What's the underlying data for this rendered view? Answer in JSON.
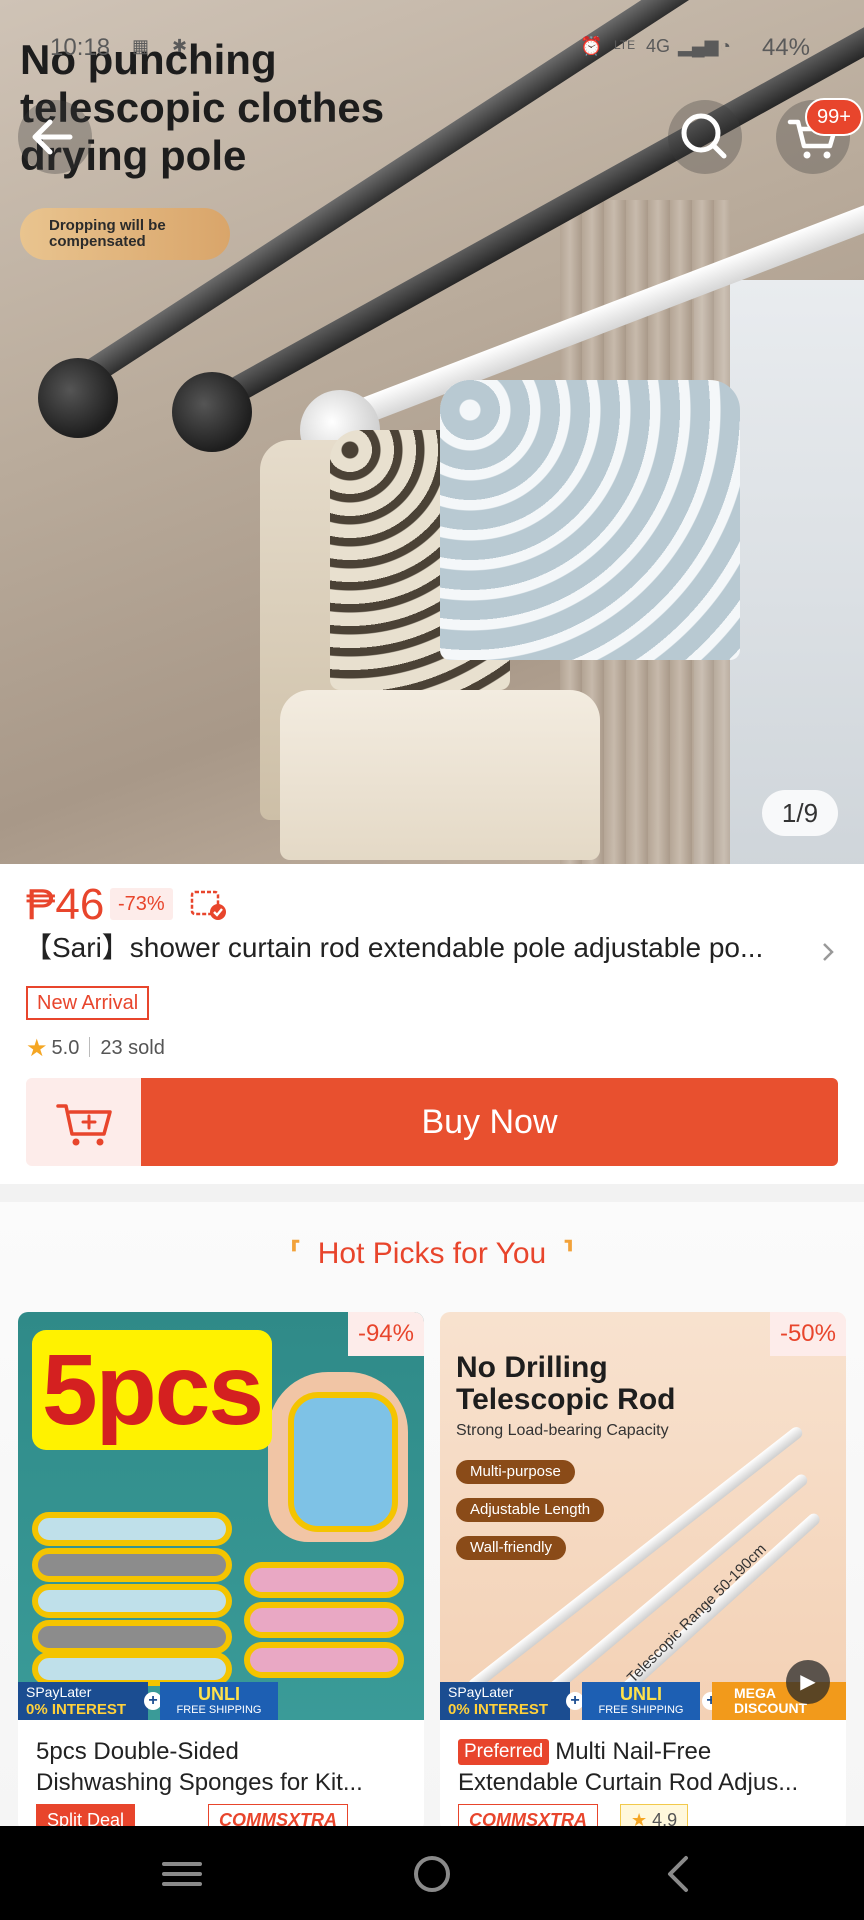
{
  "status_bar": {
    "time": "10:18",
    "network": "4G",
    "battery": "44%"
  },
  "gallery": {
    "headline": "No punching telescopic clothes drying pole",
    "pill_text": "Dropping will be compensated",
    "counter": "1/9",
    "cart_badge": "99+"
  },
  "product": {
    "price": "₱46",
    "discount": "-73%",
    "title": "【Sari】shower curtain rod  extendable pole adjustable po...",
    "tag": "New Arrival",
    "rating": "5.0",
    "sold": "23 sold",
    "buy_label": "Buy Now"
  },
  "hot_picks": {
    "heading": "Hot Picks for You",
    "items": [
      {
        "discount": "-94%",
        "image_text": "5pcs",
        "title_line1": "5pcs Double-Sided",
        "title_line2": "Dishwashing Sponges for Kit...",
        "chips": [
          "Split Deal",
          "COMMSXTRA"
        ],
        "promo": {
          "spay": "SPayLater",
          "interest": "0% INTEREST",
          "unli": "UNLI",
          "free_ship": "FREE SHIPPING"
        }
      },
      {
        "discount": "-50%",
        "image_title": "No Drilling Telescopic Rod",
        "image_sub": "Strong Load-bearing Capacity",
        "image_pills": [
          "Multi-purpose",
          "Adjustable Length",
          "Wall-friendly"
        ],
        "image_range": "Telescopic Range 50-190cm",
        "preferred": "Preferred",
        "title_line1": "Multi Nail-Free",
        "title_line2": "Extendable Curtain Rod Adjus...",
        "chips": [
          "COMMSXTRA",
          "4.9"
        ],
        "promo": {
          "spay": "SPayLater",
          "interest": "0% INTEREST",
          "unli": "UNLI",
          "free_ship": "FREE SHIPPING",
          "mega": "MEGA DISCOUNT"
        }
      }
    ]
  },
  "colors": {
    "accent": "#e8452c",
    "accent_light": "#fdecea",
    "buy_button": "#e8502f",
    "navbar": "#000000"
  },
  "icons": [
    "back-arrow-icon",
    "search-icon",
    "cart-icon",
    "add-to-cart-icon",
    "star-icon",
    "chevron-right-icon",
    "voucher-icon",
    "play-icon",
    "menu-icon",
    "home-icon",
    "back-nav-icon"
  ]
}
